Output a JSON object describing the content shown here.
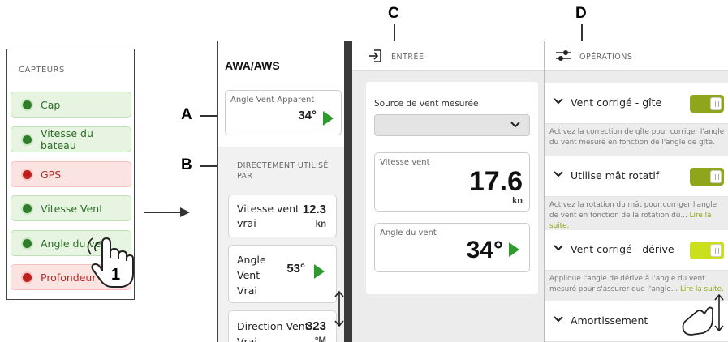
{
  "callouts": {
    "a": "A",
    "b": "B",
    "c": "C",
    "d": "D",
    "step": "1"
  },
  "sensors": {
    "title": "CAPTEURS",
    "items": [
      {
        "label": "Cap",
        "status": "ok"
      },
      {
        "label": "Vitesse du bateau",
        "status": "ok"
      },
      {
        "label": "GPS",
        "status": "error"
      },
      {
        "label": "Vitesse Vent",
        "status": "ok"
      },
      {
        "label": "Angle du vent",
        "status": "ok"
      },
      {
        "label": "Profondeur",
        "status": "error"
      }
    ]
  },
  "awa": {
    "title": "AWA/AWS",
    "card": {
      "label": "Angle Vent Apparent",
      "value": "34°"
    },
    "section_title": "DIRECTEMENT UTILISÉ PAR",
    "items": [
      {
        "name": "Vitesse vent",
        "name2": "vrai",
        "value": "12.3",
        "unit": "kn"
      },
      {
        "name": "Angle",
        "name2": "Vent",
        "name3": "Vrai",
        "value": "53°"
      },
      {
        "name": "Direction Vent",
        "name2": "Vrai",
        "value": "323",
        "unit": "°M"
      }
    ]
  },
  "entree": {
    "header": "ENTRÉE",
    "source_label": "Source de vent mesurée",
    "source_value": "",
    "speed_card": {
      "label": "Vitesse vent",
      "value": "17.6",
      "unit": "kn"
    },
    "angle_card": {
      "label": "Angle du vent",
      "value": "34°"
    }
  },
  "operations": {
    "header": "OPÉRATIONS",
    "rows": [
      {
        "label": "Vent corrigé - gîte",
        "enabled": true,
        "toggle_color": "#8fa61c"
      },
      {
        "label": "Utilise mât rotatif",
        "enabled": true,
        "toggle_color": "#8fa61c"
      },
      {
        "label": "Vent corrigé - dérive",
        "enabled": true,
        "toggle_color": "#cbe01c"
      },
      {
        "label": "Amortissement"
      }
    ],
    "desc1": "Activez la correction de gîte pour corriger l'angle du vent mesuré en fonction de l'angle de gîte.",
    "desc2": "Activez la rotation du mât pour corriger l'angle de vent en fonction de la rotation du...",
    "desc3": "Applique l'angle de dérive à l'angle du vent mesuré pour s'assurer que l'angle...",
    "read_more": "Lire la suite."
  },
  "colors": {
    "ok_green": "#2f7d2a",
    "error_red": "#c0201c",
    "arrow_green": "#2e9a2e",
    "toggle_olive": "#8fa61c",
    "toggle_lime": "#cbe01c"
  }
}
